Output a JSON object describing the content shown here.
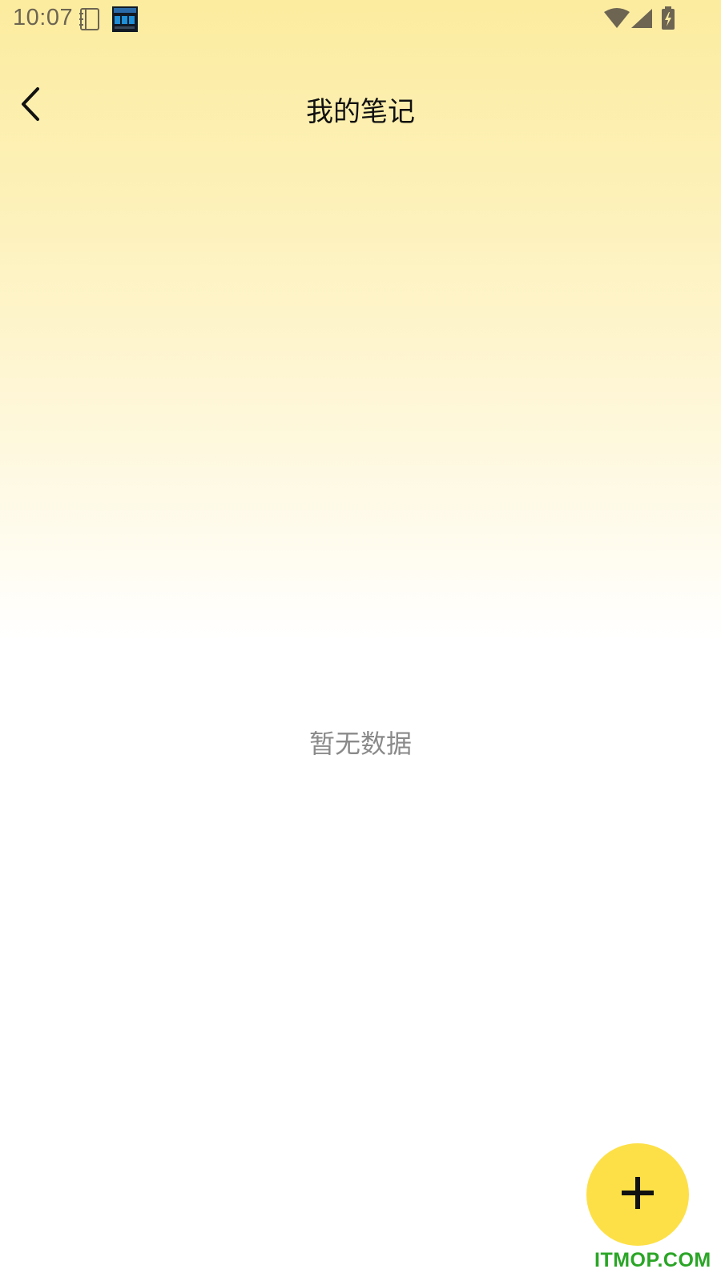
{
  "status_bar": {
    "time": "10:07",
    "notification_icons": [
      "notebook-icon",
      "clock-app-icon"
    ],
    "system_icons": [
      "wifi-icon",
      "cell-signal-icon",
      "battery-charging-icon"
    ]
  },
  "header": {
    "title": "我的笔记",
    "back_icon": "chevron-left-icon"
  },
  "main": {
    "empty_message": "暂无数据"
  },
  "fab": {
    "icon": "plus-icon",
    "color": "#fde047"
  },
  "watermark": {
    "text": "ITMOP.COM",
    "color": "#2aa526"
  },
  "colors": {
    "gradient_top": "#fcec9f",
    "background": "#ffffff"
  }
}
